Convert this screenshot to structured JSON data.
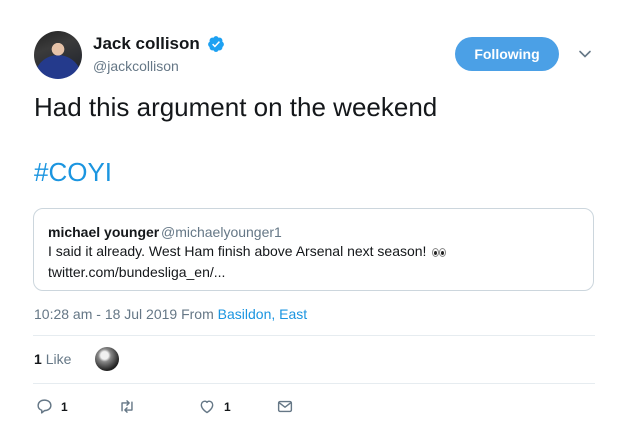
{
  "tweet": {
    "author": {
      "name": "Jack collison",
      "handle": "@jackcollison",
      "verified": true,
      "follow_button_label": "Following",
      "follow_button_color": "#4ba0e6"
    },
    "text": "Had this argument on the weekend",
    "hashtag": "#COYI",
    "hashtag_color": "#1b95e0",
    "quoted_tweet": {
      "name": "michael younger",
      "handle": "@michaelyounger1",
      "text": "I said it already. West Ham finish above Arsenal next season!",
      "emoji_icon": "eyes-icon",
      "link": "twitter.com/bundesliga_en/..."
    },
    "timestamp": "10:28 am - 18 Jul 2019 From ",
    "location": "Basildon, East",
    "likes_count": "1",
    "likes_label": "Like",
    "actions": {
      "reply_icon": "reply-icon",
      "reply_count": "1",
      "retweet_icon": "retweet-icon",
      "like_icon": "heart-icon",
      "like_count": "1",
      "message_icon": "envelope-icon"
    }
  }
}
